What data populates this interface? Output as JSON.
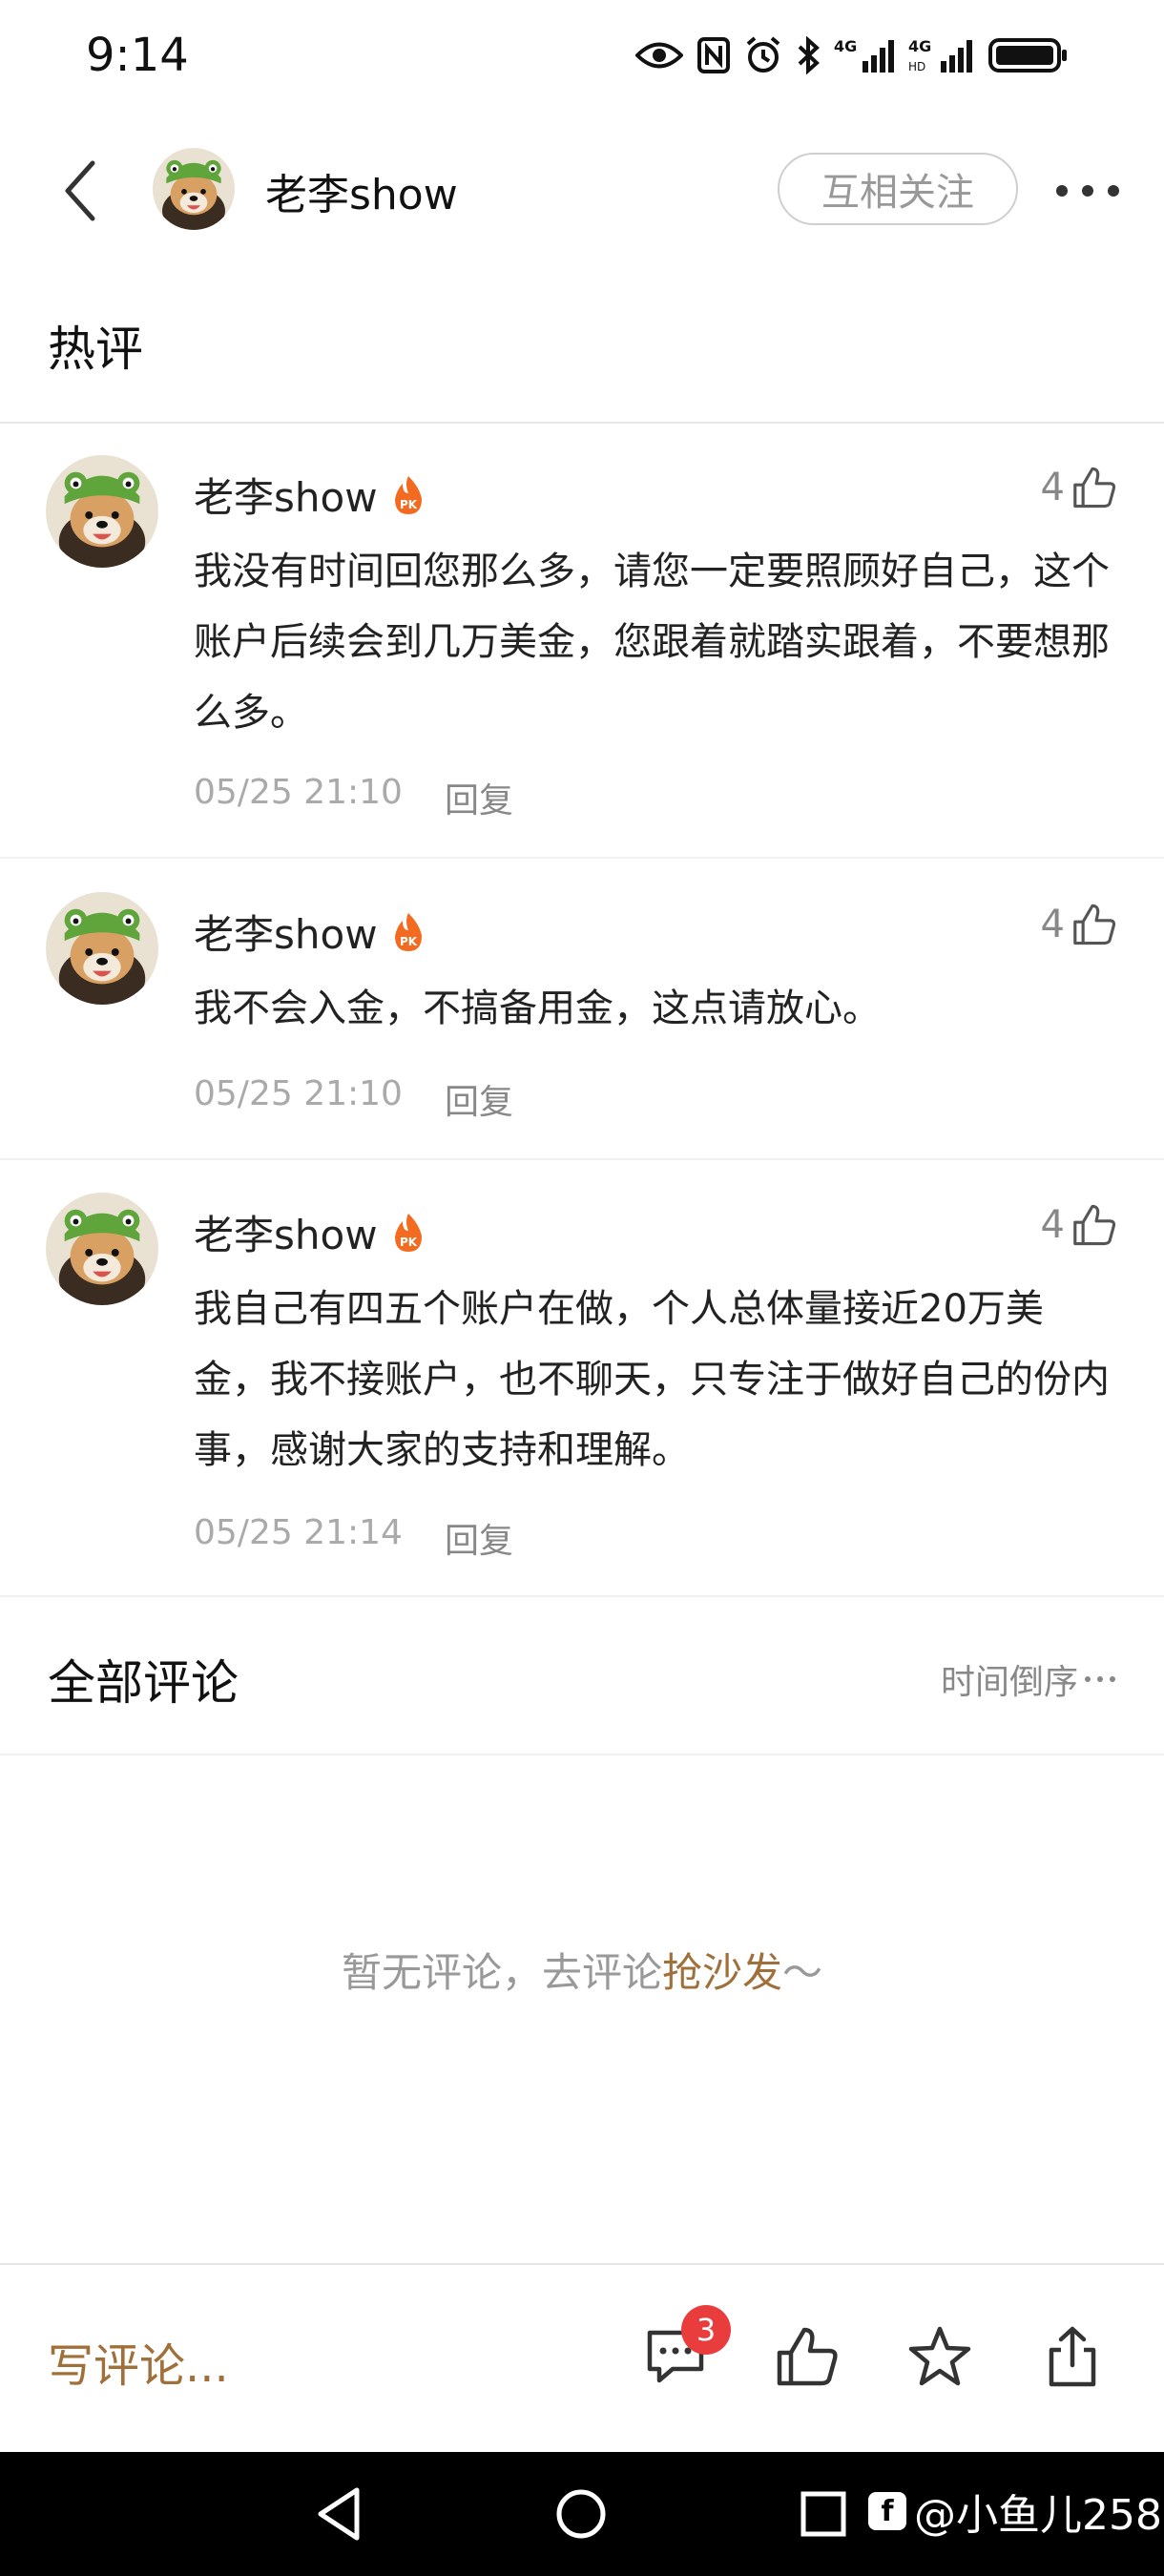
{
  "status_bar": {
    "time": "9:14",
    "icons": [
      "eye-icon",
      "nfc-icon",
      "alarm-icon",
      "bluetooth-icon",
      "signal-4g-icon",
      "signal-4g-icon",
      "battery-icon"
    ],
    "network1": "4G",
    "network2": "4G"
  },
  "header": {
    "user_name": "老李show",
    "follow_label": "互相关注"
  },
  "hot_section": {
    "title": "热评",
    "comments": [
      {
        "author": "老李show",
        "badge": "PK",
        "likes": "4",
        "text": "我没有时间回您那么多，请您一定要照顾好自己，这个账户后续会到几万美金，您跟着就踏实跟着，不要想那么多。",
        "time": "05/25 21:10",
        "reply": "回复"
      },
      {
        "author": "老李show",
        "badge": "PK",
        "likes": "4",
        "text": "我不会入金，不搞备用金，这点请放心。",
        "time": "05/25 21:10",
        "reply": "回复"
      },
      {
        "author": "老李show",
        "badge": "PK",
        "likes": "4",
        "text": "我自己有四五个账户在做，个人总体量接近20万美金，我不接账户，也不聊天，只专注于做好自己的份内事，感谢大家的支持和理解。",
        "time": "05/25 21:14",
        "reply": "回复"
      }
    ]
  },
  "all_section": {
    "title": "全部评论",
    "sort_label": "时间倒序",
    "empty_prefix": "暂无评论，去评论",
    "empty_link": "抢沙发",
    "empty_suffix": "～"
  },
  "bottom_bar": {
    "write_placeholder": "写评论...",
    "comment_count": "3"
  },
  "watermark": {
    "logo": "f",
    "text": "@小鱼儿258"
  },
  "colors": {
    "accent_brown": "#a0703b",
    "badge_red": "#e93d3d",
    "pk_orange": "#f26b21"
  }
}
